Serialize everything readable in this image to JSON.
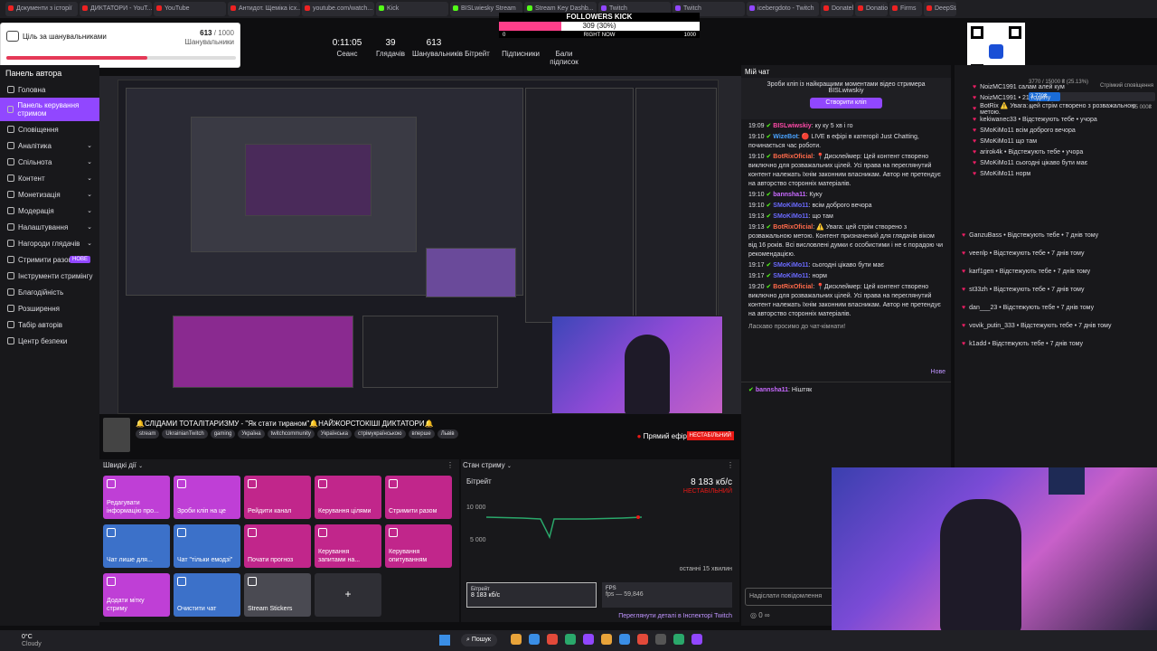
{
  "browser_tabs": [
    {
      "label": "Документи з історії",
      "type": "yt"
    },
    {
      "label": "ДИКТАТОРИ - YouT...",
      "type": "yt"
    },
    {
      "label": "YouTube",
      "type": "yt"
    },
    {
      "label": "Антидот. Щеміка ісх...",
      "type": "yt"
    },
    {
      "label": "youtube.com/watch...",
      "type": "yt"
    },
    {
      "label": "Kick",
      "type": "kk"
    },
    {
      "label": "BISLwiesky Stream",
      "type": "kk"
    },
    {
      "label": "Stream Key Dashb...",
      "type": "kk"
    },
    {
      "label": "Twitch",
      "type": "tw"
    },
    {
      "label": "Twitch",
      "type": "tw"
    },
    {
      "label": "icebergdoto - Twitch",
      "type": "tw"
    }
  ],
  "bookmarks": [
    "Donatelo",
    "Donations",
    "Firms",
    "DeepState"
  ],
  "goal": {
    "title": "Ціль за шанувальниками",
    "value": "613",
    "total": "/ 1000",
    "label": "Шанувальники",
    "progress": 0.613
  },
  "kick_widget": {
    "title": "FOLLOWERS KICK",
    "value": "309 (30%)",
    "start": "0",
    "center": "RIGHT NOW",
    "end": "1000",
    "progress": 0.309
  },
  "stats": [
    {
      "value": "0:11:05",
      "label": "Сеанс"
    },
    {
      "value": "39",
      "label": "Глядачів"
    },
    {
      "value": "613",
      "label": "Шанувальників"
    },
    {
      "value": "",
      "label": "Бітрейт"
    },
    {
      "value": "",
      "label": "Підписники"
    },
    {
      "value": "",
      "label": "Бали підписок"
    }
  ],
  "sidebar": {
    "title": "Панель автора",
    "items": [
      {
        "label": "Головна",
        "chev": false
      },
      {
        "label": "Панель керування стримом",
        "chev": false,
        "active": true
      },
      {
        "label": "Сповіщення",
        "chev": false
      },
      {
        "label": "Аналітика",
        "chev": true
      },
      {
        "label": "Спільнота",
        "chev": true
      },
      {
        "label": "Контент",
        "chev": true
      },
      {
        "label": "Монетизація",
        "chev": true
      },
      {
        "label": "Модерація",
        "chev": true
      },
      {
        "label": "Налаштування",
        "chev": true
      },
      {
        "label": "Нагороди глядачів",
        "chev": true
      },
      {
        "label": "Стримити разом",
        "badge": "НОВЕ"
      },
      {
        "label": "Інструменти стримінгу",
        "chev": false
      },
      {
        "label": "Благодійність",
        "chev": false
      },
      {
        "label": "Розширення",
        "chev": false
      },
      {
        "label": "Табір авторів",
        "chev": false
      },
      {
        "label": "Центр безпеки",
        "chev": false
      }
    ]
  },
  "stream_info": {
    "title": "🔔СЛІДАМИ ТОТАЛІТАРИЗМУ - \"Як стати тираном\"🔔НАЙЖОРСТОКІШІ ДИКТАТОРИ🔔",
    "tags": [
      "stream",
      "UkrainianTwitch",
      "gaming",
      "Україна",
      "twitchcommunity",
      "Українська",
      "стрімукраїнською",
      "вперше",
      "Львів"
    ],
    "live": "Прямий ефір",
    "unstable": "НЕСТАБІЛЬНИЙ"
  },
  "quick_actions": {
    "header": "Швидкі дії",
    "tiles": [
      {
        "label": "Редагувати інформацію про...",
        "color": "#bf3fd6"
      },
      {
        "label": "Зроби кліп на це",
        "color": "#bf3fd6"
      },
      {
        "label": "Рейдити канал",
        "color": "#c1268b"
      },
      {
        "label": "Керування цілями",
        "color": "#c1268b"
      },
      {
        "label": "Стримити разом",
        "color": "#c1268b"
      },
      {
        "label": "Чат лише для...",
        "color": "#3c71c9"
      },
      {
        "label": "Чат \"тільки емодзі\"",
        "color": "#3c71c9"
      },
      {
        "label": "Почати прогноз",
        "color": "#c1268b"
      },
      {
        "label": "Керування запитами на...",
        "color": "#c1268b"
      },
      {
        "label": "Керування опитуванням",
        "color": "#c1268b"
      },
      {
        "label": "Додати мітку стриму",
        "color": "#bf3fd6"
      },
      {
        "label": "Очистити чат",
        "color": "#3c71c9"
      },
      {
        "label": "Stream Stickers",
        "color": "#4a4a52"
      },
      {
        "label": "+",
        "color": "#2f2f35"
      }
    ]
  },
  "stream_health": {
    "header": "Стан стриму",
    "bitrate_label": "Бітрейт",
    "bitrate_value": "8 183 кб/с",
    "status": "НЕСТАБІЛЬНИЙ",
    "y_top": "10 000",
    "y_mid": "5 000",
    "period": "останні 15 хвилин",
    "card1_label": "Бітрейт",
    "card1_value": "8 183 кб/с",
    "card2_label": "FPS",
    "card2_value": "fps — 59,846",
    "link": "Переглянути деталі в Інспекторі Twitch"
  },
  "chat": {
    "header": "Мій чат",
    "banner": "Зроби кліп із найкращими моментами відео стримера BISLwiwskiy",
    "clip_button": "Створити кліп",
    "messages": [
      {
        "time": "19:09",
        "user": "BISLwiwskiy",
        "color": "#ff4aa8",
        "text": ": ку ку 5 хв і го"
      },
      {
        "time": "19:10",
        "user": "WizeBot",
        "color": "#4aa3ff",
        "text": ": 🔴 LIVE в ефірі в категорії Just Chatting, починається час роботи."
      },
      {
        "time": "19:10",
        "user": "BotRixOficial",
        "color": "#ff6a4a",
        "text": ": 📍Дисклеймер: Цей контент створено виключно для розважальних цілей. Усі права на переглянутий контент належать їхнім законним власникам. Автор не претендує на авторство сторонніх матеріалів."
      },
      {
        "time": "19:10",
        "user": "bannsha11",
        "color": "#c86aff",
        "text": ": Куку"
      },
      {
        "time": "19:10",
        "user": "SMoKiMo11",
        "color": "#6a6aff",
        "text": ": всім доброго вечора"
      },
      {
        "time": "19:13",
        "user": "SMoKiMo11",
        "color": "#6a6aff",
        "text": ": що там"
      },
      {
        "time": "19:13",
        "user": "BotRixOficial",
        "color": "#ff6a4a",
        "text": ": ⚠️ Увага: цей стрім створено з розважальною метою. Контент призначений для глядачів віком від 16 років. Всі висловлені думки є особистими і не є порадою чи рекомендацією."
      },
      {
        "time": "19:17",
        "user": "SMoKiMo11",
        "color": "#6a6aff",
        "text": ": сьогодні цікаво бути має"
      },
      {
        "time": "19:17",
        "user": "SMoKiMo11",
        "color": "#6a6aff",
        "text": ": норм"
      },
      {
        "time": "19:20",
        "user": "BotRixOficial",
        "color": "#ff6a4a",
        "text": ": 📍Дисклеймер: Цей контент створено виключно для розважальних цілей. Усі права на переглянутий контент належать їхнім законним власникам. Автор не претендує на авторство сторонніх матеріалів."
      }
    ],
    "welcome": "Ласкаво просимо до чат-кімнати!",
    "new_label": "Нове",
    "last": {
      "user": "bannsha11",
      "text": ": Ніштяк"
    },
    "input_placeholder": "Надіслати повідомлення",
    "points": "0"
  },
  "activity": {
    "header": "Стрімкий сповіщення",
    "goal_text": "3770 / 15000 ₴ (25.13%)",
    "goal_value": "3 770₴",
    "goal_start": "0",
    "goal_end": "15 000₴",
    "items": [
      {
        "text": "NoizMC1991 салам алей кум",
        "time": ""
      },
      {
        "text": "NoizMC1991 • 21 годину",
        "time": ""
      },
      {
        "text": "BotRix ⚠️ Увага: цей стрім створено з розважальною метою.",
        "time": ""
      },
      {
        "text": "kekiwanec33 • Відстежують тебе • учора",
        "time": ""
      },
      {
        "text": "SMoKiMo11 всім доброго вечора",
        "time": ""
      },
      {
        "text": "SMoKiMo11 що там",
        "time": ""
      },
      {
        "text": "arirok4k • Відстежують тебе • учора",
        "time": ""
      },
      {
        "text": "SMoKiMo11 сьогодні цікаво бути має",
        "time": ""
      },
      {
        "text": "SMoKiMo11 норм",
        "time": ""
      },
      {
        "text": "GanzuBass • Відстежують тебе • 7 днів тому",
        "time": ""
      },
      {
        "text": "veenlp • Відстежують тебе • 7 днів тому",
        "time": ""
      },
      {
        "text": "karf1gen • Відстежують тебе • 7 днів тому",
        "time": ""
      },
      {
        "text": "st33zh • Відстежують тебе • 7 днів тому",
        "time": ""
      },
      {
        "text": "dan___23 • Відстежують тебе • 7 днів тому",
        "time": ""
      },
      {
        "text": "vovik_putin_333 • Відстежують тебе • 7 днів тому",
        "time": ""
      },
      {
        "text": "k1add • Відстежують тебе • 7 днів тому",
        "time": ""
      }
    ]
  },
  "taskbar": {
    "weather_temp": "0°C",
    "weather_text": "Cloudy",
    "search": "Пошук"
  }
}
